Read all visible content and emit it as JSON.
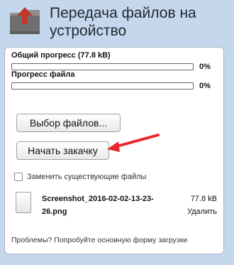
{
  "header": {
    "title": "Передача файлов на устройство",
    "icon": "folder-upload-icon"
  },
  "progress": {
    "total_label": "Общий прогресс (77.8 kB)",
    "total_percent": "0%",
    "total_value": 0,
    "file_label": "Прогресс файла",
    "file_percent": "0%",
    "file_value": 0
  },
  "buttons": {
    "select_files": "Выбор файлов...",
    "start_upload": "Начать закачку"
  },
  "options": {
    "replace_existing": "Заменить существующие файлы",
    "replace_checked": false
  },
  "file": {
    "name": "Screenshot_2016-02-02-13-23-26.png",
    "size": "77.8 kB",
    "delete": "Удалить"
  },
  "footer": {
    "text": "Проблемы? Попробуйте основную форму загрузки"
  },
  "colors": {
    "background": "#c5d7ec",
    "arrow": "#e8282e",
    "progress_fill": "#4a90d9"
  }
}
